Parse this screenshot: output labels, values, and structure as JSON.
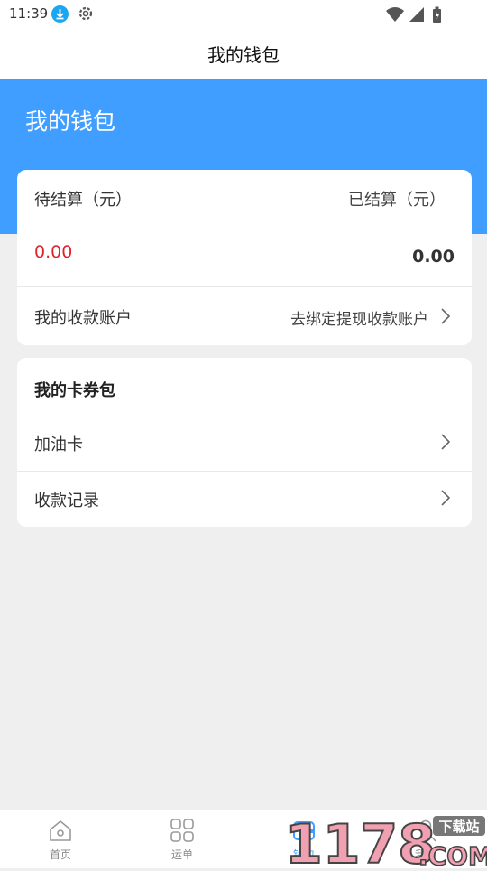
{
  "status_bar": {
    "time": "11:39",
    "icons": [
      "download-icon",
      "gear-icon",
      "wifi-icon",
      "signal-icon",
      "battery-icon"
    ]
  },
  "header": {
    "title": "我的钱包"
  },
  "hero": {
    "title": "我的钱包"
  },
  "balance_card": {
    "pending_label": "待结算（元）",
    "settled_label": "已结算（元）",
    "pending_value": "0.00",
    "settled_value": "0.00",
    "account_label": "我的收款账户",
    "account_action": "去绑定提现收款账户"
  },
  "voucher_card": {
    "title": "我的卡券包",
    "items": [
      {
        "label": "加油卡"
      },
      {
        "label": "收款记录"
      }
    ]
  },
  "tab_bar": {
    "tabs": [
      {
        "label": "首页",
        "icon": "home-icon"
      },
      {
        "label": "运单",
        "icon": "grid-icon"
      },
      {
        "label": "钱包",
        "icon": "wallet-icon",
        "active": true
      },
      {
        "label": "我的",
        "icon": "person-icon"
      }
    ]
  },
  "watermark": {
    "text": "1178",
    "suffix": ".COM",
    "badge": "下载站"
  },
  "colors": {
    "accent": "#3f9eff",
    "pending_value": "#e0222c",
    "background": "#efefef"
  }
}
